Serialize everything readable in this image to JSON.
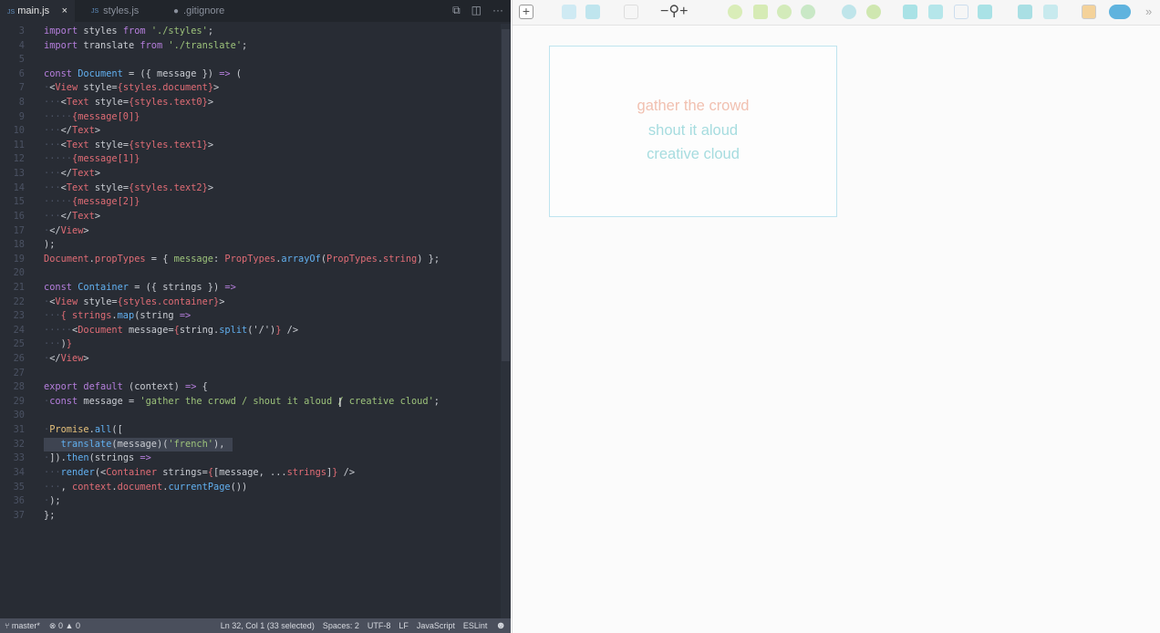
{
  "tabs": [
    {
      "label": "main.js",
      "icon": "JS"
    },
    {
      "label": "styles.js",
      "icon": "JS"
    },
    {
      "label": ".gitignore",
      "icon": "github-icon"
    }
  ],
  "tab_close": "×",
  "code": [
    {
      "n": "3",
      "t": [
        [
          "import",
          "kw"
        ],
        " styles ",
        [
          "from",
          "kw"
        ],
        " ",
        [
          "'./styles'",
          "str"
        ],
        ";"
      ]
    },
    {
      "n": "4",
      "t": [
        [
          "import",
          "kw"
        ],
        " translate ",
        [
          "from",
          "kw"
        ],
        " ",
        [
          "'./translate'",
          "str"
        ],
        ";"
      ]
    },
    {
      "n": "5",
      "t": []
    },
    {
      "n": "6",
      "t": [
        [
          "const",
          "kw"
        ],
        " ",
        [
          "Document",
          "fn"
        ],
        " = ({ message }) ",
        [
          "=>",
          "kw"
        ],
        " ("
      ]
    },
    {
      "n": "7",
      "t": [
        [
          "·",
          "dim"
        ],
        "<",
        [
          "View",
          "tag"
        ],
        " style=",
        [
          "{styles.document}",
          "obj"
        ],
        ">"
      ]
    },
    {
      "n": "8",
      "t": [
        [
          "···",
          "dim"
        ],
        "<",
        [
          "Text",
          "tag"
        ],
        " style=",
        [
          "{styles.text0}",
          "obj"
        ],
        ">"
      ]
    },
    {
      "n": "9",
      "t": [
        [
          "·····",
          "dim"
        ],
        [
          "{message[0]}",
          "obj"
        ]
      ]
    },
    {
      "n": "10",
      "t": [
        [
          "···",
          "dim"
        ],
        "</",
        [
          "Text",
          "tag"
        ],
        ">"
      ]
    },
    {
      "n": "11",
      "t": [
        [
          "···",
          "dim"
        ],
        "<",
        [
          "Text",
          "tag"
        ],
        " style=",
        [
          "{styles.text1}",
          "obj"
        ],
        ">"
      ]
    },
    {
      "n": "12",
      "t": [
        [
          "·····",
          "dim"
        ],
        [
          "{message[1]}",
          "obj"
        ]
      ]
    },
    {
      "n": "13",
      "t": [
        [
          "···",
          "dim"
        ],
        "</",
        [
          "Text",
          "tag"
        ],
        ">"
      ]
    },
    {
      "n": "14",
      "t": [
        [
          "···",
          "dim"
        ],
        "<",
        [
          "Text",
          "tag"
        ],
        " style=",
        [
          "{styles.text2}",
          "obj"
        ],
        ">"
      ]
    },
    {
      "n": "15",
      "t": [
        [
          "·····",
          "dim"
        ],
        [
          "{message[2]}",
          "obj"
        ]
      ]
    },
    {
      "n": "16",
      "t": [
        [
          "···",
          "dim"
        ],
        "</",
        [
          "Text",
          "tag"
        ],
        ">"
      ]
    },
    {
      "n": "17",
      "t": [
        [
          "·",
          "dim"
        ],
        "</",
        [
          "View",
          "tag"
        ],
        ">"
      ]
    },
    {
      "n": "18",
      "t": [
        ");"
      ]
    },
    {
      "n": "19",
      "t": [
        [
          "Document",
          "obj"
        ],
        ".",
        [
          "propTypes",
          "obj"
        ],
        " = { ",
        [
          "message",
          "str"
        ],
        ": ",
        [
          "PropTypes",
          "obj"
        ],
        ".",
        [
          "arrayOf",
          "fn"
        ],
        "(",
        [
          "PropTypes",
          "obj"
        ],
        ".",
        [
          "string",
          "obj"
        ],
        ") };"
      ]
    },
    {
      "n": "20",
      "t": []
    },
    {
      "n": "21",
      "t": [
        [
          "const",
          "kw"
        ],
        " ",
        [
          "Container",
          "fn"
        ],
        " = ({ strings }) ",
        [
          "=>",
          "kw"
        ]
      ]
    },
    {
      "n": "22",
      "t": [
        [
          "·",
          "dim"
        ],
        "<",
        [
          "View",
          "tag"
        ],
        " style=",
        [
          "{styles.container}",
          "obj"
        ],
        ">"
      ]
    },
    {
      "n": "23",
      "t": [
        [
          "···",
          "dim"
        ],
        [
          "{ strings",
          "obj"
        ],
        ".",
        [
          "map",
          "fn"
        ],
        "(string ",
        [
          "=>",
          "kw"
        ]
      ]
    },
    {
      "n": "24",
      "t": [
        [
          "·····",
          "dim"
        ],
        "<",
        [
          "Document",
          "tag"
        ],
        " message=",
        [
          "{",
          "obj"
        ],
        "string.",
        [
          "split",
          "fn"
        ],
        "('/')",
        [
          "}",
          "obj"
        ],
        " />"
      ]
    },
    {
      "n": "25",
      "t": [
        [
          "···",
          "dim"
        ],
        ")",
        [
          "}",
          "obj"
        ]
      ]
    },
    {
      "n": "26",
      "t": [
        [
          "·",
          "dim"
        ],
        "</",
        [
          "View",
          "tag"
        ],
        ">"
      ]
    },
    {
      "n": "27",
      "t": []
    },
    {
      "n": "28",
      "t": [
        [
          "export",
          "kw"
        ],
        " ",
        [
          "default",
          "kw"
        ],
        " (context) ",
        [
          "=>",
          "kw"
        ],
        " {"
      ]
    },
    {
      "n": "29",
      "t": [
        [
          "·",
          "dim"
        ],
        [
          "const",
          "kw"
        ],
        " message = ",
        [
          "'gather the crowd / shout it aloud / creative cloud'",
          "str"
        ],
        ";"
      ]
    },
    {
      "n": "30",
      "t": []
    },
    {
      "n": "31",
      "t": [
        [
          "·",
          "dim"
        ],
        [
          "Promise",
          "yel"
        ],
        ".",
        [
          "all",
          "fn"
        ],
        "(["
      ]
    },
    {
      "n": "32",
      "sel": true,
      "t": [
        "   ",
        [
          "translate",
          "fn"
        ],
        "(message)(",
        [
          "'french'",
          "str"
        ],
        "),"
      ]
    },
    {
      "n": "33",
      "t": [
        [
          "·",
          "dim"
        ],
        "]).",
        [
          "then",
          "fn"
        ],
        "(strings ",
        [
          "=>",
          "kw"
        ]
      ]
    },
    {
      "n": "34",
      "t": [
        [
          "···",
          "dim"
        ],
        [
          "render",
          "fn"
        ],
        "(<",
        [
          "Container",
          "tag"
        ],
        " strings=",
        [
          "{",
          "obj"
        ],
        "[message, ...",
        [
          "strings",
          "obj"
        ],
        "]",
        [
          "}",
          "obj"
        ],
        " />"
      ]
    },
    {
      "n": "35",
      "t": [
        [
          "···",
          "dim"
        ],
        ", ",
        [
          "context",
          "obj"
        ],
        ".",
        [
          "document",
          "obj"
        ],
        ".",
        [
          "currentPage",
          "fn"
        ],
        "())"
      ]
    },
    {
      "n": "36",
      "t": [
        [
          "·",
          "dim"
        ],
        ");"
      ]
    },
    {
      "n": "37",
      "t": [
        "};"
      ]
    }
  ],
  "status": {
    "branch": "master*",
    "errors": "0",
    "warnings": "0",
    "position": "Ln 32, Col 1 (33 selected)",
    "spaces": "Spaces: 2",
    "encoding": "UTF-8",
    "eol": "LF",
    "language": "JavaScript",
    "linter": "ESLint"
  },
  "artboard": {
    "lines": [
      {
        "text": "gather the crowd",
        "color": "#f1c0b0"
      },
      {
        "text": "shout it aloud",
        "color": "#a6dcdf"
      },
      {
        "text": "creative cloud",
        "color": "#a6dcdf"
      }
    ]
  }
}
